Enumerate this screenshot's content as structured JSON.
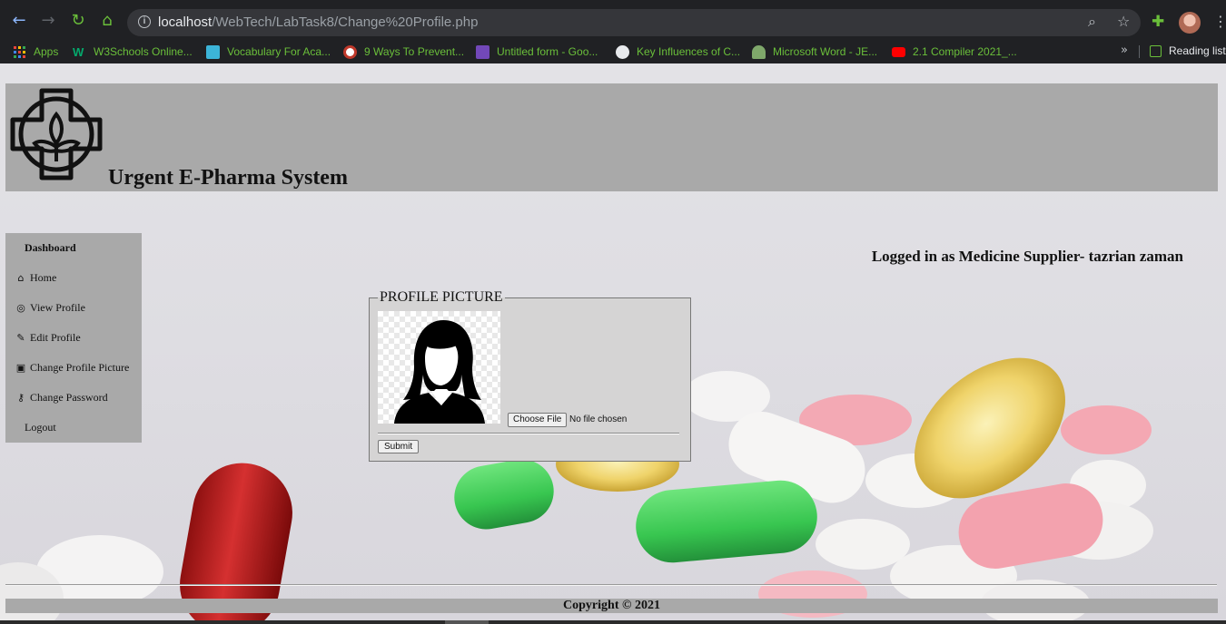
{
  "browser": {
    "url_host": "localhost",
    "url_path": "/WebTech/LabTask8/Change%20Profile.php",
    "bookmarks": [
      {
        "label": "Apps",
        "icon": "apps-grid-icon",
        "color": "#e8453c"
      },
      {
        "label": "W3Schools Online...",
        "icon": "w3schools-icon",
        "color": "#04aa6d"
      },
      {
        "label": "Vocabulary For Aca...",
        "icon": "vocabulary-icon",
        "color": "#3cb4d8"
      },
      {
        "label": "9 Ways To Prevent...",
        "icon": "prevent-icon",
        "color": "#ffffff"
      },
      {
        "label": "Untitled form - Goo...",
        "icon": "google-forms-icon",
        "color": "#7248b9"
      },
      {
        "label": "Key Influences of C...",
        "icon": "key-influences-icon",
        "color": "#e8eaed"
      },
      {
        "label": "Microsoft Word - JE...",
        "icon": "word-doc-icon",
        "color": "#7fa86b"
      },
      {
        "label": "2.1 Compiler 2021_...",
        "icon": "youtube-icon",
        "color": "#ff0000"
      }
    ],
    "reading_list": "Reading list"
  },
  "header": {
    "title": "Urgent E-Pharma System"
  },
  "sidebar": {
    "heading": "Dashboard",
    "items": [
      {
        "label": "Home",
        "icon": "home-icon",
        "glyph": "⌂"
      },
      {
        "label": "View Profile",
        "icon": "user-circle-icon",
        "glyph": "◎"
      },
      {
        "label": "Edit Profile",
        "icon": "user-edit-icon",
        "glyph": "✎"
      },
      {
        "label": "Change Profile Picture",
        "icon": "file-image-icon",
        "glyph": "▣"
      },
      {
        "label": "Change Password",
        "icon": "key-icon",
        "glyph": "⚷"
      },
      {
        "label": "Logout",
        "icon": "",
        "glyph": ""
      }
    ]
  },
  "status": {
    "logged_in": "Logged in as Medicine Supplier- tazrian zaman"
  },
  "form": {
    "legend": "PROFILE PICTURE",
    "choose_file": "Choose File",
    "file_status": "No file chosen",
    "submit": "Submit"
  },
  "footer": {
    "copyright": "Copyright © 2021"
  }
}
